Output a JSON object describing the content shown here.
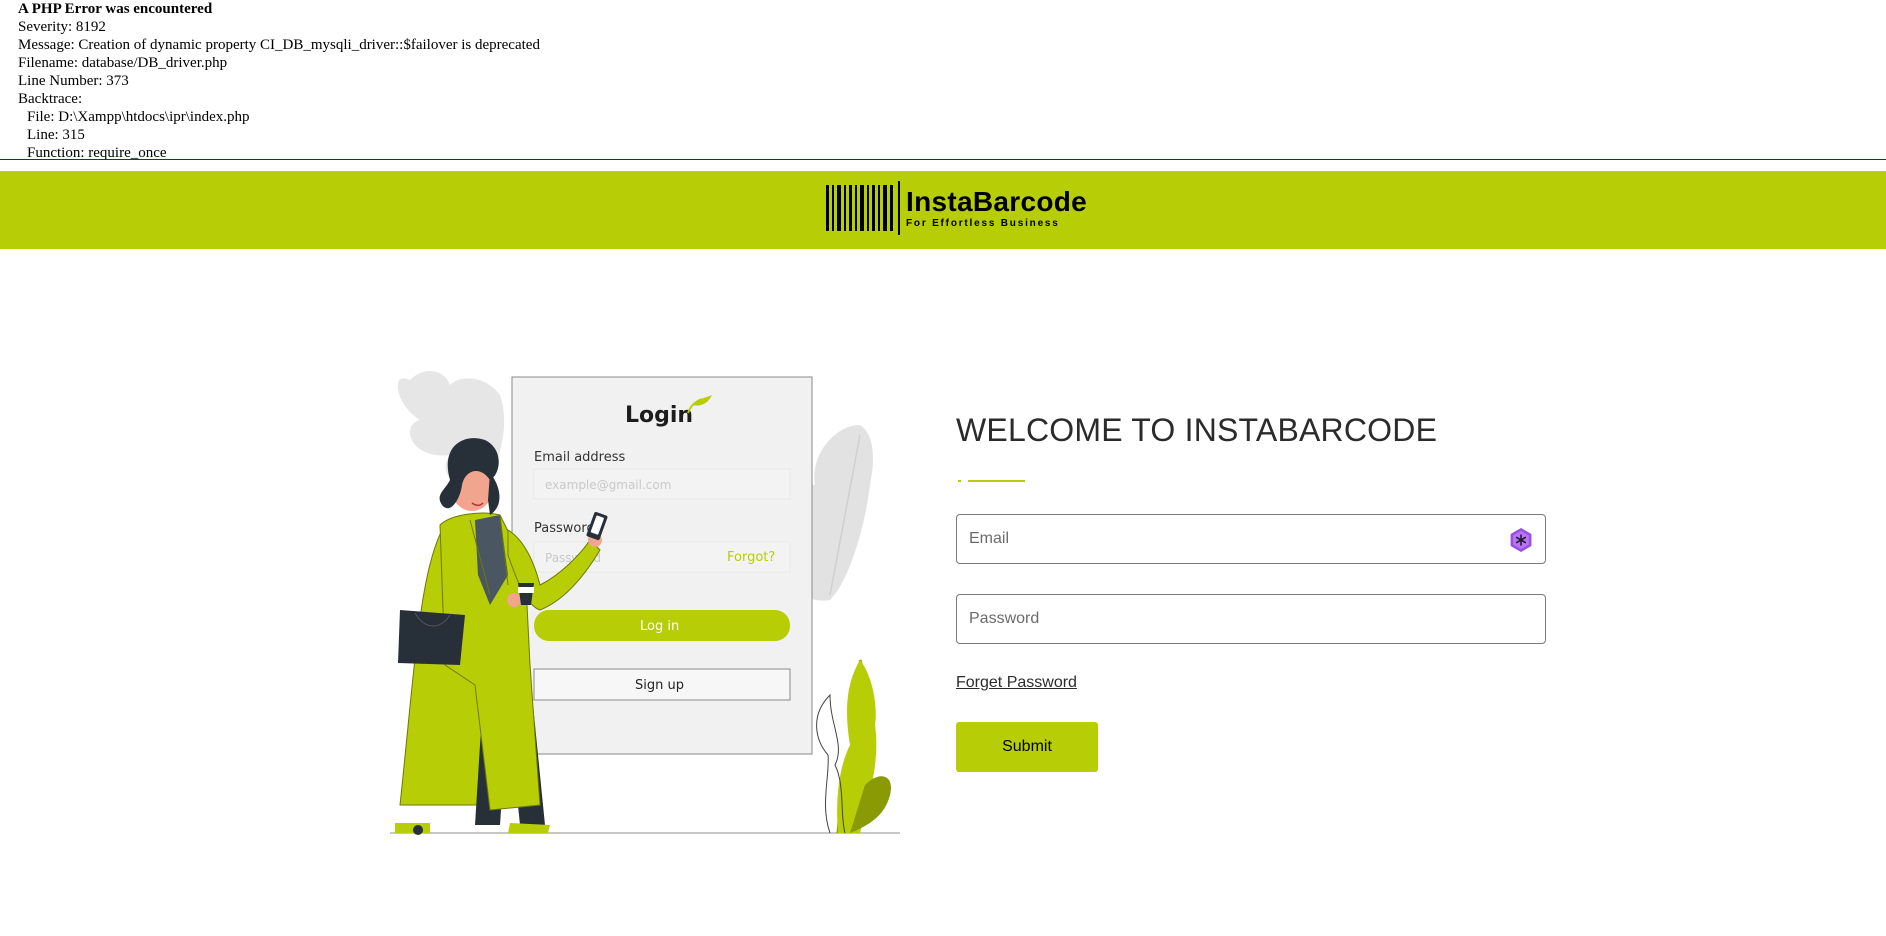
{
  "php_error": {
    "heading": "A PHP Error was encountered",
    "severity": "Severity: 8192",
    "message": "Message: Creation of dynamic property CI_DB_mysqli_driver::$failover is deprecated",
    "filename": "Filename: database/DB_driver.php",
    "line_number": "Line Number: 373",
    "backtrace_label": "Backtrace:",
    "backtrace": {
      "file": "File: D:\\Xampp\\htdocs\\ipr\\index.php",
      "line": "Line: 315",
      "function": "Function: require_once"
    }
  },
  "header": {
    "brand": "InstaBarcode",
    "tagline": "For Effortless Business",
    "background_color": "#b7cd06",
    "logo_icon": "barcode-icon"
  },
  "illustration": {
    "card_title": "Login",
    "email_label": "Email address",
    "email_placeholder": "example@gmail.com",
    "password_label": "Password",
    "password_placeholder": "Password",
    "forgot_link": "Forgot?",
    "login_button": "Log in",
    "signup_button": "Sign up"
  },
  "main": {
    "welcome_title": "WELCOME TO INSTABARCODE",
    "email_placeholder": "Email",
    "password_placeholder": "Password",
    "forget_password_link": "Forget Password",
    "submit_button": "Submit",
    "accent_color": "#b7cd06",
    "email_extension_icon": "password-manager-icon"
  }
}
